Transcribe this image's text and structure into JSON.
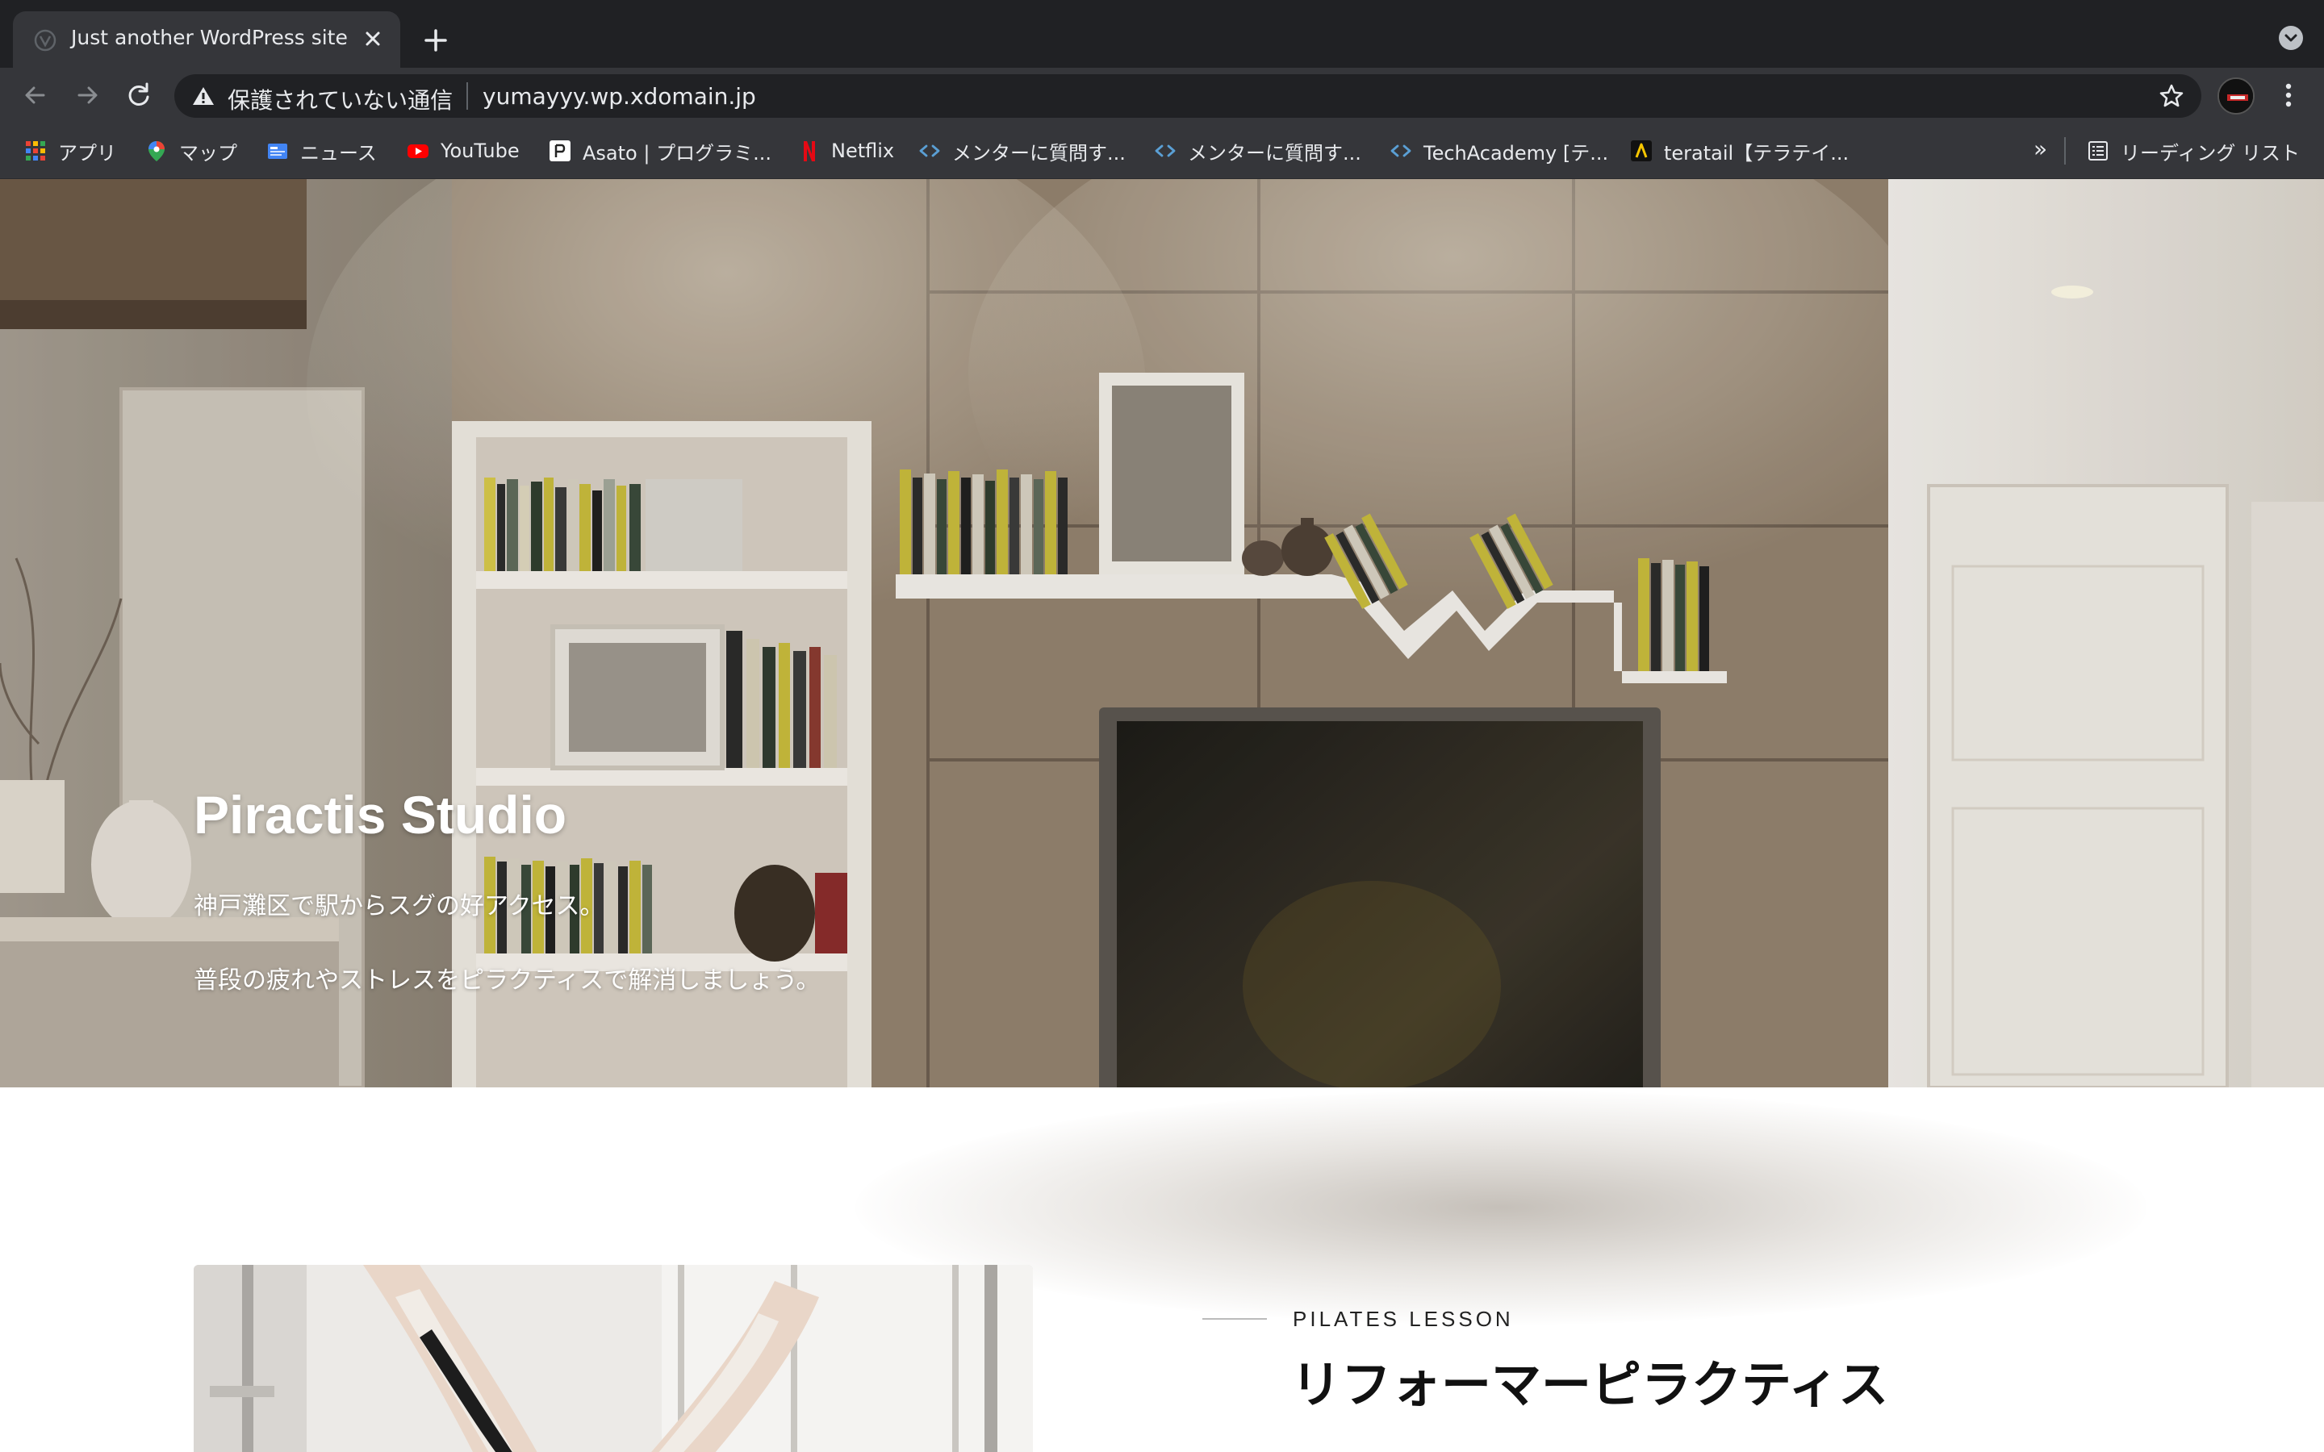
{
  "browser": {
    "tab_title": "Just another WordPress site",
    "security_label": "保護されていない通信",
    "url": "yumayyy.wp.xdomain.jp",
    "bookmarks": [
      {
        "label": "アプリ",
        "icon": "apps-grid-icon"
      },
      {
        "label": "マップ",
        "icon": "maps-pin-icon"
      },
      {
        "label": "ニュース",
        "icon": "news-icon"
      },
      {
        "label": "YouTube",
        "icon": "youtube-icon"
      },
      {
        "label": "Asato | プログラミ...",
        "icon": "asato-icon"
      },
      {
        "label": "Netflix",
        "icon": "netflix-icon"
      },
      {
        "label": "メンターに質問す...",
        "icon": "code-icon"
      },
      {
        "label": "メンターに質問す...",
        "icon": "code-icon"
      },
      {
        "label": "TechAcademy [テ...",
        "icon": "code-icon"
      },
      {
        "label": "teratail【テラテイ...",
        "icon": "teratail-icon"
      }
    ],
    "more_bookmarks": "»",
    "reading_list": "リーディング リスト"
  },
  "hero": {
    "title": "Piractis Studio",
    "line1": "神戸灘区で駅からスグの好アクセス。",
    "line2": "普段の疲れやストレスをピラクティスで解消しましょう。"
  },
  "lesson": {
    "label": "PILATES LESSON",
    "heading": "リフォーマーピラクティス"
  },
  "colors": {
    "chrome_dark": "#202124",
    "chrome_mid": "#35363a",
    "chrome_text": "#e8eaed"
  }
}
